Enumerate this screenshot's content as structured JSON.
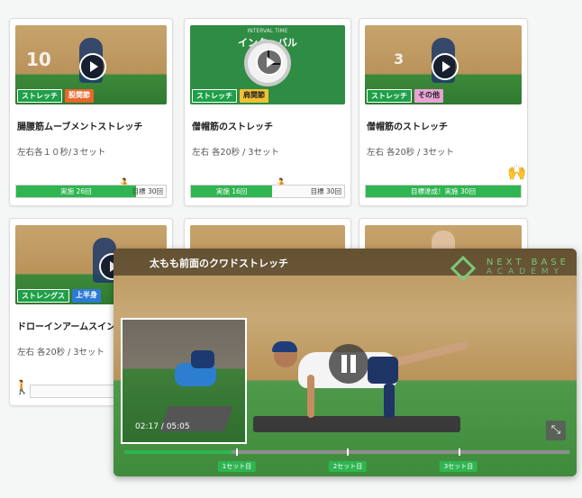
{
  "cards": [
    {
      "title": "腸腰筋ムーブメントストレッチ",
      "subtitle": "左右各１０秒/３セット",
      "tags": [
        {
          "label": "ストレッチ",
          "color": "green"
        },
        {
          "label": "股関節",
          "color": "orange"
        }
      ],
      "thumb_text": "10",
      "done_label": "実施 26回",
      "goal_label": "目標 30回",
      "progress": 0.8,
      "icon": "runner-icon"
    },
    {
      "title": "僧帽筋のストレッチ",
      "subtitle": "左右 各20秒 / 3セット",
      "tags": [
        {
          "label": "ストレッチ",
          "color": "green"
        },
        {
          "label": "肩関節",
          "color": "yellow"
        }
      ],
      "interval_small": "INTERVAL TIME",
      "interval_label": "インターバル",
      "done_label": "実施 16回",
      "goal_label": "目標 30回",
      "progress": 0.53,
      "icon": "runner-icon"
    },
    {
      "title": "僧帽筋のストレッチ",
      "subtitle": "左右 各20秒 / 3セット",
      "tags": [
        {
          "label": "ストレッチ",
          "color": "green"
        },
        {
          "label": "その他",
          "color": "pink"
        }
      ],
      "thumb_text": "3",
      "done_label": "目標達成！実施 30回",
      "goal_label": "",
      "progress": 1.0,
      "icon": "cheer-icon"
    },
    {
      "title": "ドローインアームスイン",
      "subtitle": "左右 各20秒 / 3セット",
      "tags": [
        {
          "label": "ストレングス",
          "color": "green"
        },
        {
          "label": "上半身",
          "color": "blue"
        }
      ],
      "icon": "walker-icon"
    }
  ],
  "player": {
    "title": "太もも前面のクワドストレッチ",
    "brand_line1": "NEXT BASE",
    "brand_line2": "ACADEMY",
    "pip_time": "02:17 / 05:05",
    "progress": 0.24,
    "sets": [
      "1セット目",
      "2セット目",
      "3セット目"
    ]
  },
  "colors": {
    "accent": "#2fb551"
  }
}
